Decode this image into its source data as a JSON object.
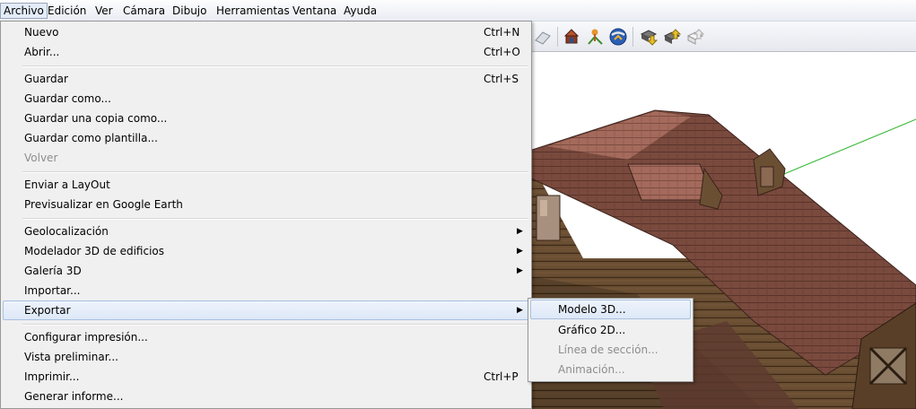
{
  "menubar": {
    "items": [
      "Archivo",
      "Edición",
      "Ver",
      "Cámara",
      "Dibujo",
      "Herramientas",
      "Ventana",
      "Ayuda"
    ],
    "active_index": 0
  },
  "toolbar": {
    "icons": [
      "section-plane-icon",
      "warehouse-model-icon",
      "add-location-icon",
      "google-earth-icon",
      "get-models-icon",
      "share-model-icon",
      "share-component-icon"
    ]
  },
  "archivo_menu": {
    "items": [
      {
        "label": "Nuevo",
        "shortcut": "Ctrl+N"
      },
      {
        "label": "Abrir...",
        "shortcut": "Ctrl+O"
      },
      {
        "label": "Guardar",
        "shortcut": "Ctrl+S"
      },
      {
        "label": "Guardar como..."
      },
      {
        "label": "Guardar una copia como..."
      },
      {
        "label": "Guardar como plantilla..."
      },
      {
        "label": "Volver",
        "disabled": true
      },
      {
        "label": "Enviar a LayOut"
      },
      {
        "label": "Previsualizar en Google Earth"
      },
      {
        "label": "Geolocalización",
        "submenu": true
      },
      {
        "label": "Modelador 3D de edificios",
        "submenu": true
      },
      {
        "label": "Galería 3D",
        "submenu": true
      },
      {
        "label": "Importar..."
      },
      {
        "label": "Exportar",
        "submenu": true,
        "highlighted": true
      },
      {
        "label": "Configurar impresión..."
      },
      {
        "label": "Vista preliminar..."
      },
      {
        "label": "Imprimir...",
        "shortcut": "Ctrl+P"
      },
      {
        "label": "Generar informe..."
      }
    ]
  },
  "exportar_submenu": {
    "items": [
      {
        "label": "Modelo 3D...",
        "highlighted": true
      },
      {
        "label": "Gráfico 2D..."
      },
      {
        "label": "Línea de sección...",
        "disabled": true
      },
      {
        "label": "Animación...",
        "disabled": true
      }
    ]
  },
  "colors": {
    "menu_bg": "#f0f0f0",
    "highlight_border": "#a9c0e2",
    "disabled_text": "#8d8d8d",
    "roof": "#7a4a3e",
    "wood": "#6b4f33",
    "green_axis": "#2fb52f"
  }
}
